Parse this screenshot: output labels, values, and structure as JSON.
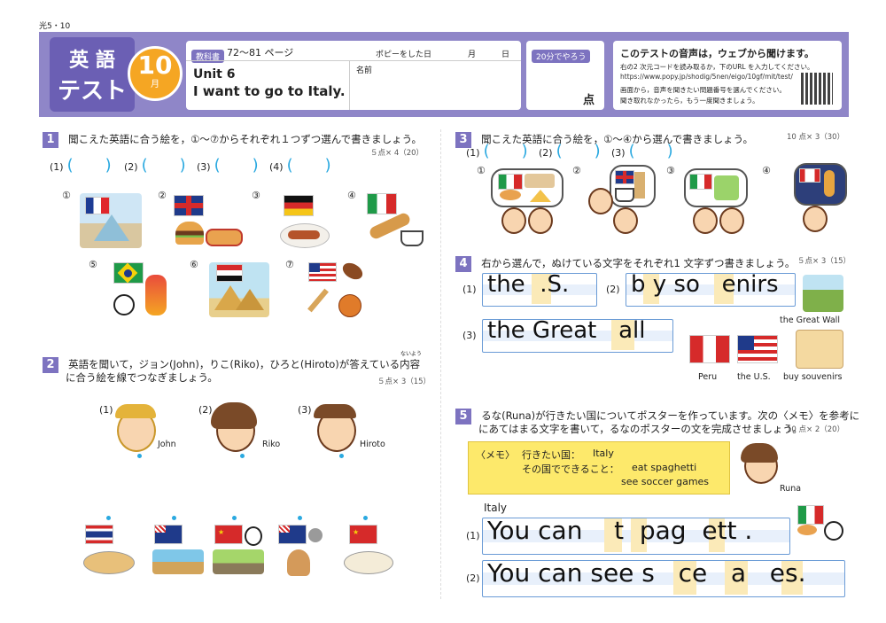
{
  "page_id": "光5・10",
  "header": {
    "title_line1": "英 語",
    "title_line2": "テスト",
    "month_num": "10",
    "month_unit": "月",
    "textbook_label": "教科書",
    "textbook_pages": "72〜81 ページ",
    "date_label": "ポピーをした日",
    "month_char": "月",
    "day_char": "日",
    "unit": "Unit 6",
    "unit_title": "I want to go to Italy.",
    "name_label": "名前",
    "time_badge": "20分でやろう",
    "score_label": "点",
    "audio_title": "このテストの音声は，ウェブから聞けます。",
    "audio_line1": "右の2 次元コードを読み取るか，下のURL を入力してください。",
    "audio_url": "https://www.popy.jp/shodig/5nen/eigo/10gf/mit/test/",
    "audio_line2": "画面から，音声を聞きたい問題番号を選んでください。",
    "audio_line3": "聞き取れなかったら，もう一度聞きましょう。"
  },
  "q1": {
    "num": "1",
    "text": "聞こえた英語に合う絵を，①〜⑦からそれぞれ１つずつ選んで書きましょう。",
    "points": "５点× 4（20）",
    "answers": [
      "(1)",
      "(2)",
      "(3)",
      "(4)"
    ],
    "open": "(",
    "close": ")",
    "options": [
      "①",
      "②",
      "③",
      "④",
      "⑤",
      "⑥",
      "⑦"
    ]
  },
  "q2": {
    "num": "2",
    "text1": "英語を聞いて，ジョン(John)，りこ(Riko)，ひろと(Hiroto)が答えている内容",
    "ruby": "ないよう",
    "text2": "に合う絵を線でつなぎましょう。",
    "points": "５点× 3（15）",
    "people": [
      {
        "num": "(1)",
        "name": "John"
      },
      {
        "num": "(2)",
        "name": "Riko"
      },
      {
        "num": "(3)",
        "name": "Hiroto"
      }
    ]
  },
  "q3": {
    "num": "3",
    "text": "聞こえた英語に合う絵を，①〜④から選んで書きましょう。",
    "points": "10 点× 3（30）",
    "answers": [
      "(1)",
      "(2)",
      "(3)"
    ],
    "open": "(",
    "close": ")",
    "options": [
      "①",
      "②",
      "③",
      "④"
    ]
  },
  "q4": {
    "num": "4",
    "text": "右から選んで，ぬけている文字をそれぞれ1 文字ずつ書きましょう。",
    "points": "５点× 3（15）",
    "items": [
      {
        "num": "(1)",
        "text": "the  .S."
      },
      {
        "num": "(2)",
        "text": "b y so   enirs"
      },
      {
        "num": "(3)",
        "text": "the Great   all"
      }
    ],
    "labels": [
      "the Great Wall",
      "Peru",
      "the U.S.",
      "buy souvenirs"
    ]
  },
  "q5": {
    "num": "5",
    "text1": "るな(Runa)が行きたい国についてポスターを作っています。次の〈メモ〉を参考に",
    "text2": "にあてはまる文字を書いて，るなのポスターの文を完成させましょう。",
    "points": "10 点× 2（20）",
    "memo_title": "〈メモ〉",
    "memo_country_label": "行きたい国：",
    "memo_country": "Italy",
    "memo_can_label": "その国でできること：",
    "memo_can1": "eat spaghetti",
    "memo_can2": "see soccer games",
    "person": "Runa",
    "poster_country": "Italy",
    "sentences": [
      {
        "num": "(1)",
        "text": "You can    t  pag  ett ."
      },
      {
        "num": "(2)",
        "text": "You can see s   ce   a   es."
      }
    ]
  },
  "colors": {
    "accent": "#7d73c0",
    "header_band": "#8f86c8",
    "month": "#f5a623",
    "bracket": "#2aa9e0",
    "memo": "#fde96b"
  }
}
